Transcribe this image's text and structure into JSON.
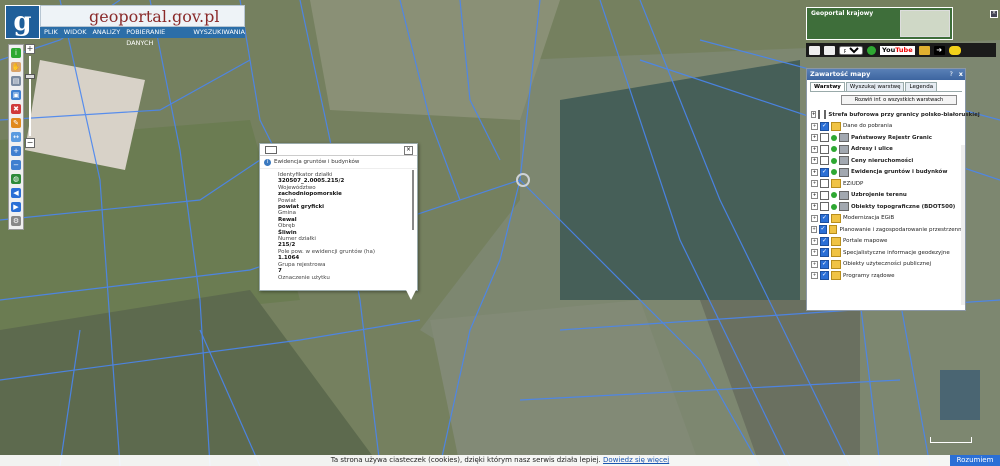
{
  "header": {
    "logo_letter": "g",
    "brand": "geoportal.gov.pl",
    "menu": [
      "PLIK",
      "WIDOK",
      "ANALIZY",
      "POBIERANIE DANYCH",
      "WYSZUKIWANIA"
    ]
  },
  "popup": {
    "title": "Ewidencja gruntów i budynków",
    "fields": [
      {
        "label": "Identyfikator działki",
        "value": "320507_2.0005.215/2"
      },
      {
        "label": "Województwo",
        "value": "zachodniopomorskie"
      },
      {
        "label": "Powiat",
        "value": "powiat gryficki"
      },
      {
        "label": "Gmina",
        "value": "Rewal"
      },
      {
        "label": "Obręb",
        "value": "Śliwin"
      },
      {
        "label": "Numer działki",
        "value": "215/2"
      },
      {
        "label": "Pole pow. w ewidencji gruntów (ha)",
        "value": "1.1064"
      },
      {
        "label": "Grupa rejestrowa",
        "value": "7"
      },
      {
        "label": "Oznaczenie użytku",
        "value": ""
      }
    ]
  },
  "geoportal_krajowy": {
    "title": "Geoportal krajowy"
  },
  "toolbar2": {
    "language": "pol",
    "youtube": "You",
    "youtube_b": "Tube"
  },
  "panel": {
    "title": "Zawartość mapy",
    "help": "?",
    "close": "x",
    "tabs": [
      "Warstwy",
      "Wyszukaj warstwę",
      "Legenda"
    ],
    "expand_button": "Rozwiń inf. o wszystkich warstwach",
    "layers": [
      {
        "label": "Strefa buforowa przy granicy polsko-białoruskiej",
        "checked": false,
        "bold": true,
        "icon": "dot"
      },
      {
        "label": "Dane do pobrania",
        "checked": true,
        "bold": false,
        "icon": "folder"
      },
      {
        "label": "Państwowy Rejestr Granic",
        "checked": false,
        "bold": true,
        "icon": "dot"
      },
      {
        "label": "Adresy i ulice",
        "checked": false,
        "bold": true,
        "icon": "dot"
      },
      {
        "label": "Ceny nieruchomości",
        "checked": false,
        "bold": true,
        "icon": "dot"
      },
      {
        "label": "Ewidencja gruntów i budynków",
        "checked": true,
        "bold": true,
        "icon": "dot"
      },
      {
        "label": "EZiUDP",
        "checked": false,
        "bold": false,
        "icon": "folder"
      },
      {
        "label": "Uzbrojenie terenu",
        "checked": false,
        "bold": true,
        "icon": "dot"
      },
      {
        "label": "Obiekty topograficzne (BDOT500)",
        "checked": false,
        "bold": true,
        "icon": "dot"
      },
      {
        "label": "Modernizacja EGiB",
        "checked": true,
        "bold": false,
        "icon": "folder"
      },
      {
        "label": "Planowanie i zagospodarowanie przestrzenne",
        "checked": true,
        "bold": false,
        "icon": "folder"
      },
      {
        "label": "Portale mapowe",
        "checked": true,
        "bold": false,
        "icon": "folder"
      },
      {
        "label": "Specjalistyczne informacje geodezyjne",
        "checked": true,
        "bold": false,
        "icon": "folder"
      },
      {
        "label": "Obiekty użyteczności publicznej",
        "checked": true,
        "bold": false,
        "icon": "folder"
      },
      {
        "label": "Programy rządowe",
        "checked": true,
        "bold": false,
        "icon": "folder"
      }
    ]
  },
  "cookie": {
    "text": "Ta strona używa ciasteczek (cookies), dzięki którym nasz serwis działa lepiej.",
    "link": "Dowiedz się więcej",
    "button": "Rozumiem"
  },
  "colors": {
    "parcel_line": "#3f7fe8",
    "header_blue": "#2c6ea8",
    "panel_blue": "#3d65a0"
  }
}
